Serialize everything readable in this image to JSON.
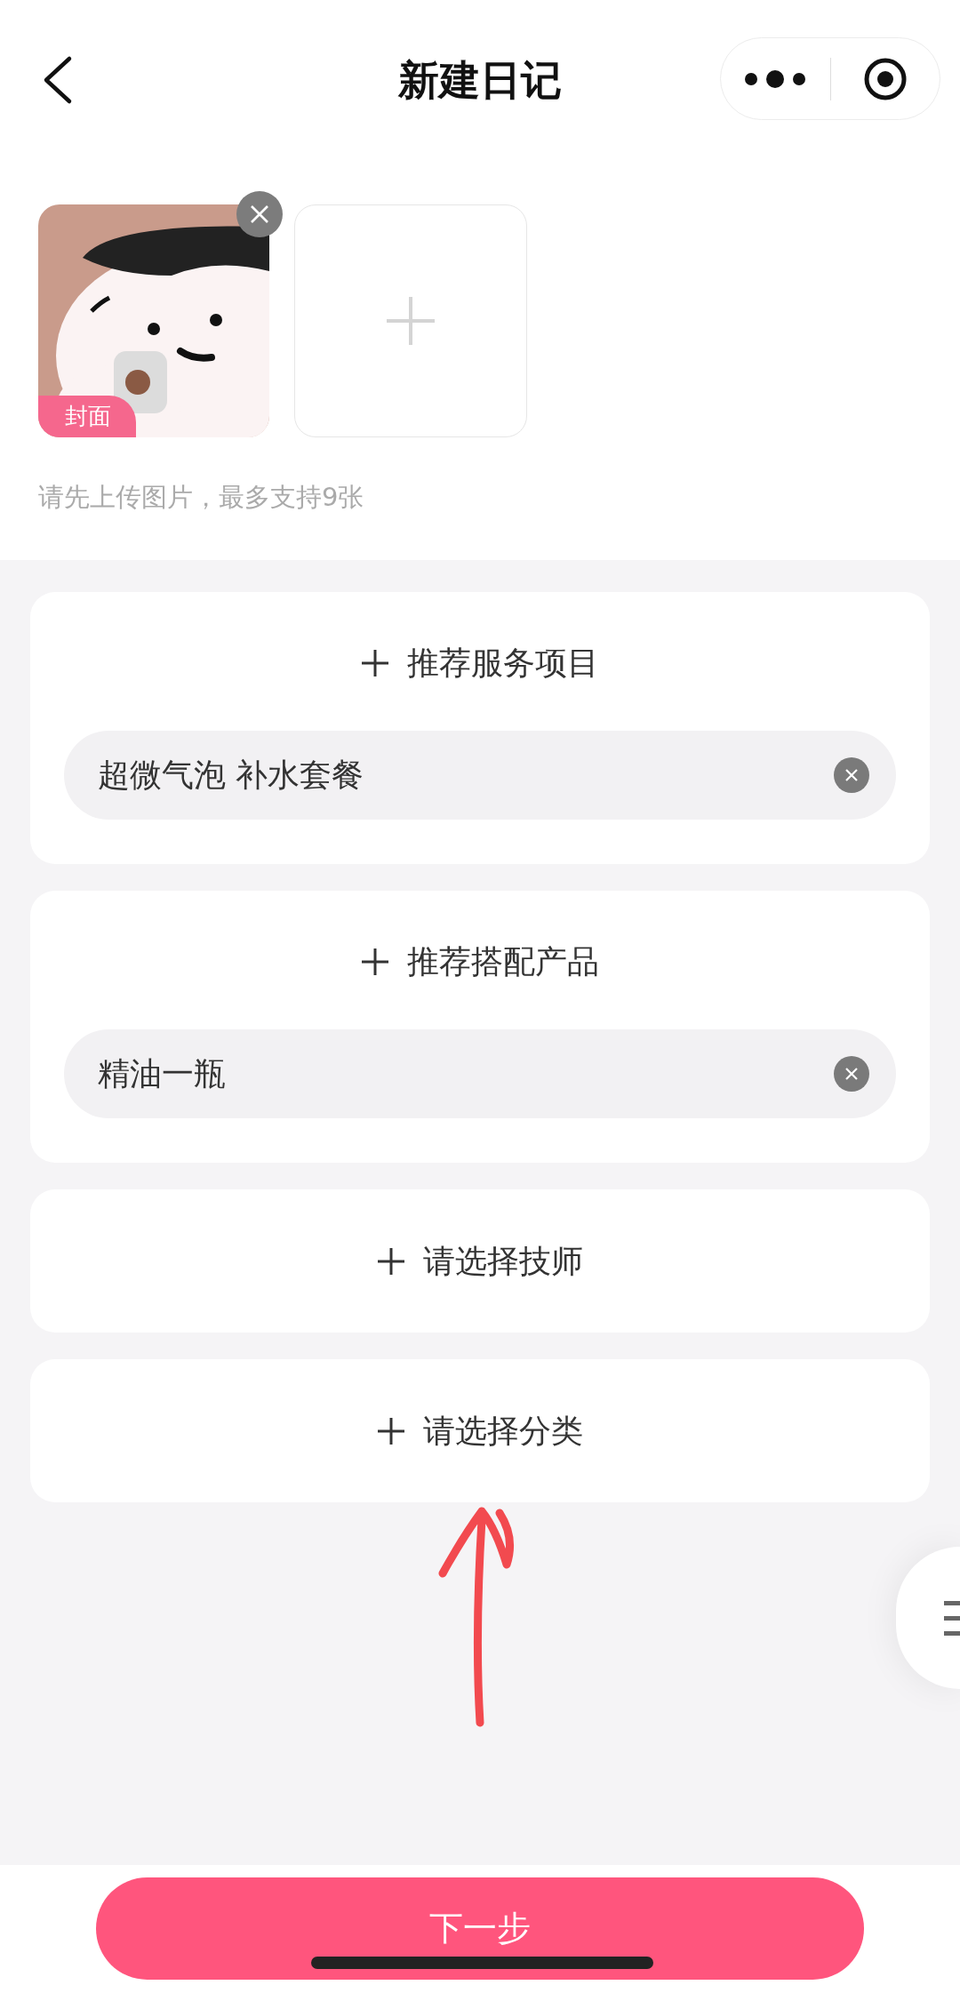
{
  "header": {
    "title": "新建日记"
  },
  "photos": [
    {
      "kind": "picture",
      "cover_label": "封面",
      "removable": true
    },
    {
      "kind": "add"
    }
  ],
  "upload_hint": "请先上传图片，最多支持9张",
  "cards": [
    {
      "title": "推荐服务项目",
      "chosen": "超微气泡 补水套餐"
    },
    {
      "title": "推荐搭配产品",
      "chosen": "精油一瓶"
    },
    {
      "title": "请选择技师"
    },
    {
      "title": "请选择分类"
    }
  ],
  "next_button": {
    "label": "下一步"
  }
}
